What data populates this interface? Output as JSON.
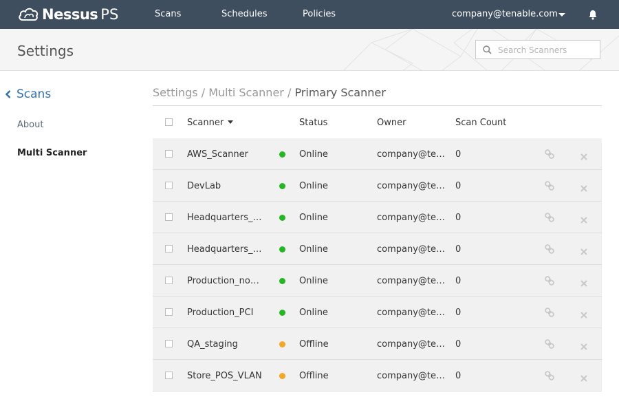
{
  "app": {
    "logo_name": "Nessus",
    "logo_suffix": "PS"
  },
  "nav": {
    "items": [
      "Scans",
      "Schedules",
      "Policies"
    ],
    "user": "company@tenable.com"
  },
  "header": {
    "title": "Settings",
    "search_placeholder": "Search Scanners"
  },
  "sidebar": {
    "back_label": "Scans",
    "items": [
      {
        "label": "About",
        "active": false
      },
      {
        "label": "Multi Scanner",
        "active": true
      }
    ]
  },
  "breadcrumb": {
    "parts": [
      "Settings",
      "Multi Scanner"
    ],
    "separator": "/",
    "current": "Primary Scanner"
  },
  "table": {
    "columns": [
      "Scanner",
      "Status",
      "Owner",
      "Scan Count"
    ],
    "rows": [
      {
        "name": "AWS_Scanner",
        "status": "Online",
        "owner": "company@tenable.com",
        "count": "0"
      },
      {
        "name": "DevLab",
        "status": "Online",
        "owner": "company@tenable.com",
        "count": "0"
      },
      {
        "name": "Headquarters_Datacenter",
        "status": "Online",
        "owner": "company@tenable.com",
        "count": "0"
      },
      {
        "name": "Headquarters_Finance",
        "status": "Online",
        "owner": "company@tenable.com",
        "count": "0"
      },
      {
        "name": "Production_nonPCI",
        "status": "Online",
        "owner": "company@tenable.com",
        "count": "0"
      },
      {
        "name": "Production_PCI",
        "status": "Online",
        "owner": "company@tenable.com",
        "count": "0"
      },
      {
        "name": "QA_staging",
        "status": "Offline",
        "owner": "company@tenable.com",
        "count": "0"
      },
      {
        "name": "Store_POS_VLAN",
        "status": "Offline",
        "owner": "company@tenable.com",
        "count": "0"
      }
    ]
  },
  "colors": {
    "topbar": "#3f4e5e",
    "accent": "#2f6fb3",
    "online": "#22b822",
    "offline": "#f5a623"
  },
  "icons": [
    "nessus-cloud-logo-icon",
    "bell-icon",
    "search-icon",
    "chevron-left-icon",
    "sort-caret-icon",
    "link-icon",
    "close-icon"
  ]
}
